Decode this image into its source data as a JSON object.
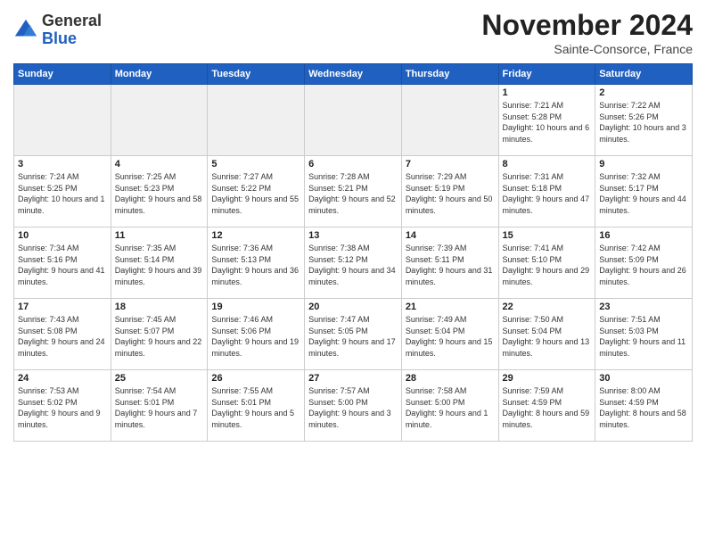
{
  "header": {
    "logo_general": "General",
    "logo_blue": "Blue",
    "title": "November 2024",
    "location": "Sainte-Consorce, France"
  },
  "days_of_week": [
    "Sunday",
    "Monday",
    "Tuesday",
    "Wednesday",
    "Thursday",
    "Friday",
    "Saturday"
  ],
  "weeks": [
    [
      {
        "day": "",
        "empty": true
      },
      {
        "day": "",
        "empty": true
      },
      {
        "day": "",
        "empty": true
      },
      {
        "day": "",
        "empty": true
      },
      {
        "day": "",
        "empty": true
      },
      {
        "day": "1",
        "sunrise": "Sunrise: 7:21 AM",
        "sunset": "Sunset: 5:28 PM",
        "daylight": "Daylight: 10 hours and 6 minutes."
      },
      {
        "day": "2",
        "sunrise": "Sunrise: 7:22 AM",
        "sunset": "Sunset: 5:26 PM",
        "daylight": "Daylight: 10 hours and 3 minutes."
      }
    ],
    [
      {
        "day": "3",
        "sunrise": "Sunrise: 7:24 AM",
        "sunset": "Sunset: 5:25 PM",
        "daylight": "Daylight: 10 hours and 1 minute."
      },
      {
        "day": "4",
        "sunrise": "Sunrise: 7:25 AM",
        "sunset": "Sunset: 5:23 PM",
        "daylight": "Daylight: 9 hours and 58 minutes."
      },
      {
        "day": "5",
        "sunrise": "Sunrise: 7:27 AM",
        "sunset": "Sunset: 5:22 PM",
        "daylight": "Daylight: 9 hours and 55 minutes."
      },
      {
        "day": "6",
        "sunrise": "Sunrise: 7:28 AM",
        "sunset": "Sunset: 5:21 PM",
        "daylight": "Daylight: 9 hours and 52 minutes."
      },
      {
        "day": "7",
        "sunrise": "Sunrise: 7:29 AM",
        "sunset": "Sunset: 5:19 PM",
        "daylight": "Daylight: 9 hours and 50 minutes."
      },
      {
        "day": "8",
        "sunrise": "Sunrise: 7:31 AM",
        "sunset": "Sunset: 5:18 PM",
        "daylight": "Daylight: 9 hours and 47 minutes."
      },
      {
        "day": "9",
        "sunrise": "Sunrise: 7:32 AM",
        "sunset": "Sunset: 5:17 PM",
        "daylight": "Daylight: 9 hours and 44 minutes."
      }
    ],
    [
      {
        "day": "10",
        "sunrise": "Sunrise: 7:34 AM",
        "sunset": "Sunset: 5:16 PM",
        "daylight": "Daylight: 9 hours and 41 minutes."
      },
      {
        "day": "11",
        "sunrise": "Sunrise: 7:35 AM",
        "sunset": "Sunset: 5:14 PM",
        "daylight": "Daylight: 9 hours and 39 minutes."
      },
      {
        "day": "12",
        "sunrise": "Sunrise: 7:36 AM",
        "sunset": "Sunset: 5:13 PM",
        "daylight": "Daylight: 9 hours and 36 minutes."
      },
      {
        "day": "13",
        "sunrise": "Sunrise: 7:38 AM",
        "sunset": "Sunset: 5:12 PM",
        "daylight": "Daylight: 9 hours and 34 minutes."
      },
      {
        "day": "14",
        "sunrise": "Sunrise: 7:39 AM",
        "sunset": "Sunset: 5:11 PM",
        "daylight": "Daylight: 9 hours and 31 minutes."
      },
      {
        "day": "15",
        "sunrise": "Sunrise: 7:41 AM",
        "sunset": "Sunset: 5:10 PM",
        "daylight": "Daylight: 9 hours and 29 minutes."
      },
      {
        "day": "16",
        "sunrise": "Sunrise: 7:42 AM",
        "sunset": "Sunset: 5:09 PM",
        "daylight": "Daylight: 9 hours and 26 minutes."
      }
    ],
    [
      {
        "day": "17",
        "sunrise": "Sunrise: 7:43 AM",
        "sunset": "Sunset: 5:08 PM",
        "daylight": "Daylight: 9 hours and 24 minutes."
      },
      {
        "day": "18",
        "sunrise": "Sunrise: 7:45 AM",
        "sunset": "Sunset: 5:07 PM",
        "daylight": "Daylight: 9 hours and 22 minutes."
      },
      {
        "day": "19",
        "sunrise": "Sunrise: 7:46 AM",
        "sunset": "Sunset: 5:06 PM",
        "daylight": "Daylight: 9 hours and 19 minutes."
      },
      {
        "day": "20",
        "sunrise": "Sunrise: 7:47 AM",
        "sunset": "Sunset: 5:05 PM",
        "daylight": "Daylight: 9 hours and 17 minutes."
      },
      {
        "day": "21",
        "sunrise": "Sunrise: 7:49 AM",
        "sunset": "Sunset: 5:04 PM",
        "daylight": "Daylight: 9 hours and 15 minutes."
      },
      {
        "day": "22",
        "sunrise": "Sunrise: 7:50 AM",
        "sunset": "Sunset: 5:04 PM",
        "daylight": "Daylight: 9 hours and 13 minutes."
      },
      {
        "day": "23",
        "sunrise": "Sunrise: 7:51 AM",
        "sunset": "Sunset: 5:03 PM",
        "daylight": "Daylight: 9 hours and 11 minutes."
      }
    ],
    [
      {
        "day": "24",
        "sunrise": "Sunrise: 7:53 AM",
        "sunset": "Sunset: 5:02 PM",
        "daylight": "Daylight: 9 hours and 9 minutes."
      },
      {
        "day": "25",
        "sunrise": "Sunrise: 7:54 AM",
        "sunset": "Sunset: 5:01 PM",
        "daylight": "Daylight: 9 hours and 7 minutes."
      },
      {
        "day": "26",
        "sunrise": "Sunrise: 7:55 AM",
        "sunset": "Sunset: 5:01 PM",
        "daylight": "Daylight: 9 hours and 5 minutes."
      },
      {
        "day": "27",
        "sunrise": "Sunrise: 7:57 AM",
        "sunset": "Sunset: 5:00 PM",
        "daylight": "Daylight: 9 hours and 3 minutes."
      },
      {
        "day": "28",
        "sunrise": "Sunrise: 7:58 AM",
        "sunset": "Sunset: 5:00 PM",
        "daylight": "Daylight: 9 hours and 1 minute."
      },
      {
        "day": "29",
        "sunrise": "Sunrise: 7:59 AM",
        "sunset": "Sunset: 4:59 PM",
        "daylight": "Daylight: 8 hours and 59 minutes."
      },
      {
        "day": "30",
        "sunrise": "Sunrise: 8:00 AM",
        "sunset": "Sunset: 4:59 PM",
        "daylight": "Daylight: 8 hours and 58 minutes."
      }
    ]
  ]
}
